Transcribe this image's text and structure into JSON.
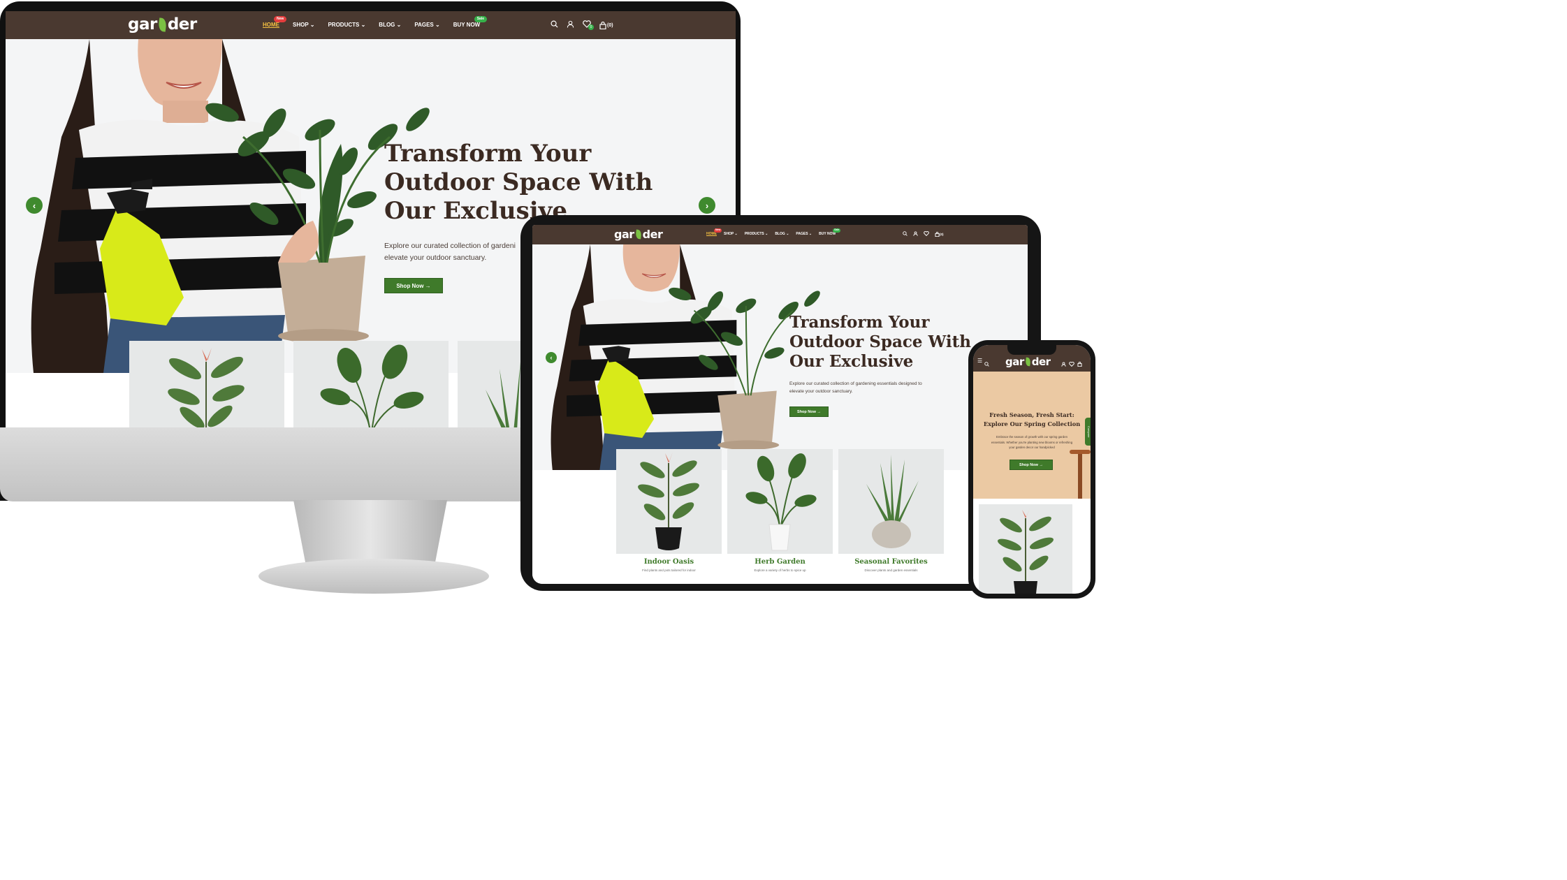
{
  "brand": {
    "logo_text_left": "gar",
    "logo_text_right": "der"
  },
  "nav": {
    "items": [
      {
        "label": "HOME",
        "badge": "New",
        "active": true
      },
      {
        "label": "SHOP",
        "caret": true
      },
      {
        "label": "PRODUCTS",
        "caret": true
      },
      {
        "label": "BLOG",
        "caret": true
      },
      {
        "label": "PAGES",
        "caret": true
      },
      {
        "label": "BUY NOW",
        "badge": "Sale"
      }
    ],
    "wishlist_count": "0",
    "cart_count": "(0)"
  },
  "hero": {
    "title_line1": "Transform Your",
    "title_line2": "Outdoor Space With",
    "title_line3": "Our Exclusive",
    "desc_desktop_line1": "Explore our curated collection of gardeni",
    "desc_desktop_line2": "elevate your outdoor sanctuary.",
    "desc_tablet_line1": "Explore our curated collection of gardening essentials designed to",
    "desc_tablet_line2": "elevate your outdoor sanctuary.",
    "button": "Shop Now →"
  },
  "cards": [
    {
      "title": "Indoor Oasis",
      "desc": "Find plants and pots tailored for indoor"
    },
    {
      "title": "Herb Garden",
      "desc": "Explore a variety of herbs to spice up"
    },
    {
      "title": "Seasonal Favorites",
      "desc": "Discover plants and garden essentials"
    }
  ],
  "mobile_hero": {
    "title_line1": "Fresh Season, Fresh Start:",
    "title_line2": "Explore Our Spring Collection",
    "desc_line1": "Embrace the season of growth with our spring garden",
    "desc_line2": "essentials. Whether you're planting new blooms or refreshing",
    "desc_line3": "your garden decor our handpicked",
    "button": "Shop Now →",
    "side_tab": "Compare"
  },
  "colors": {
    "nav_bg": "#4a3930",
    "accent_green": "#3f7a2a",
    "badge_new": "#e43d3d",
    "badge_sale": "#36b24a"
  }
}
